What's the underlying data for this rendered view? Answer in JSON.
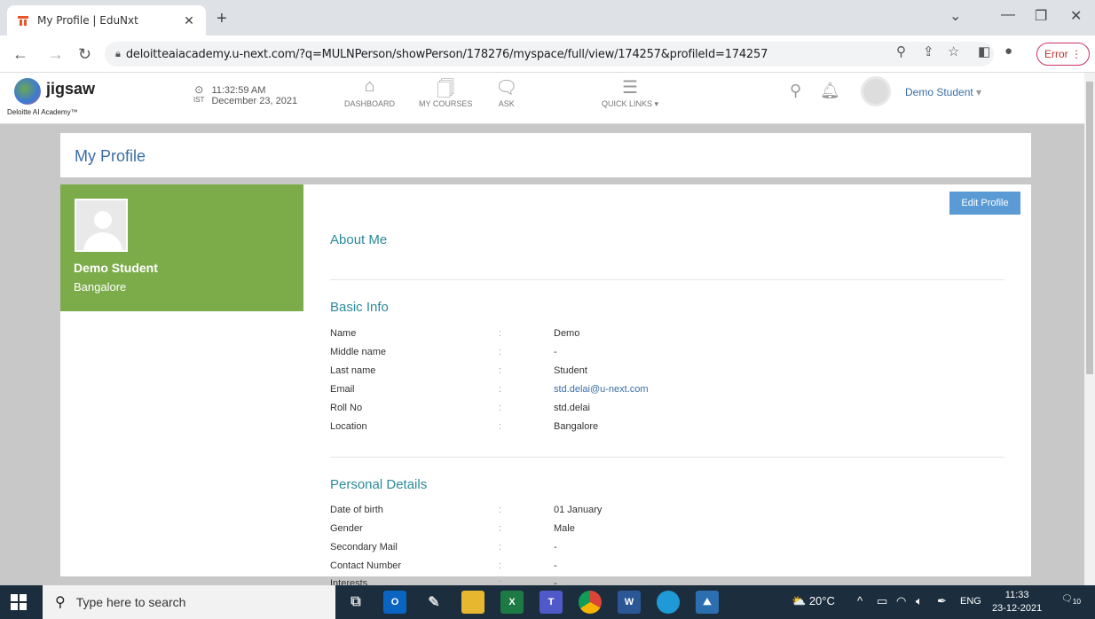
{
  "browser": {
    "tab_title": "My Profile | EduNxt",
    "url": "deloitteaiacademy.u-next.com/?q=MULNPerson/showPerson/178276/myspace/full/view/174257&profileId=174257",
    "error_label": "Error"
  },
  "header": {
    "logo_name": "jigsaw",
    "logo_tag": "Deloitte AI Academy™",
    "time": "11:32:59 AM",
    "date": "December 23, 2021",
    "tz": "IST",
    "nav": [
      {
        "label": "DASHBOARD"
      },
      {
        "label": "MY COURSES"
      },
      {
        "label": "ASK"
      },
      {
        "label": "QUICK LINKS"
      }
    ],
    "user_name": "Demo Student"
  },
  "page": {
    "title": "My Profile",
    "edit_label": "Edit Profile",
    "profile_name": "Demo Student",
    "profile_city": "Bangalore",
    "about_heading": "About Me",
    "basic_heading": "Basic Info",
    "basic": [
      {
        "k": "Name",
        "v": "Demo"
      },
      {
        "k": "Middle name",
        "v": "-"
      },
      {
        "k": "Last name",
        "v": "Student"
      },
      {
        "k": "Email",
        "v": "std.delai@u-next.com"
      },
      {
        "k": "Roll No",
        "v": "std.delai"
      },
      {
        "k": "Location",
        "v": "Bangalore"
      }
    ],
    "personal_heading": "Personal Details",
    "personal": [
      {
        "k": "Date of birth",
        "v": "01 January"
      },
      {
        "k": "Gender",
        "v": "Male"
      },
      {
        "k": "Secondary Mail",
        "v": "-"
      },
      {
        "k": "Contact Number",
        "v": "-"
      },
      {
        "k": "Interests",
        "v": "-"
      }
    ],
    "colon": ":"
  },
  "taskbar": {
    "search_placeholder": "Type here to search",
    "weather": "20°C",
    "lang": "ENG",
    "time": "11:33",
    "date": "23-12-2021",
    "notif_count": "10"
  },
  "colors": {
    "accent": "#3a6ea5",
    "green_panel": "#7cac4a",
    "section_heading": "#2a8a9a",
    "edit_button": "#5b9bd5"
  }
}
